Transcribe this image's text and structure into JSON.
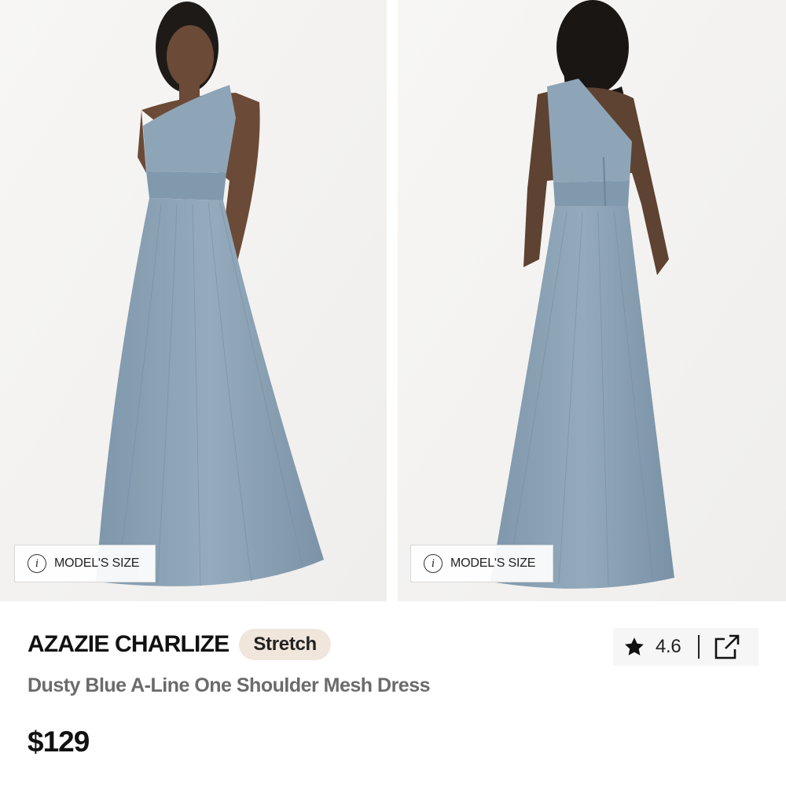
{
  "gallery": {
    "images": [
      {
        "name": "front-view",
        "model_size_label": "MODEL'S SIZE"
      },
      {
        "name": "back-view",
        "model_size_label": "MODEL'S SIZE"
      }
    ]
  },
  "product": {
    "brand": "AZAZIE CHARLIZE",
    "badge": "Stretch",
    "subtitle": "Dusty Blue A-Line One Shoulder Mesh Dress",
    "price": "$129",
    "rating": "4.6"
  },
  "icons": {
    "info": "info-icon",
    "star": "star-icon",
    "share": "share-icon"
  },
  "colors": {
    "dress": "#8ea5b8",
    "badge_bg": "#f1e6dc",
    "subtitle": "#6b6b6b"
  }
}
